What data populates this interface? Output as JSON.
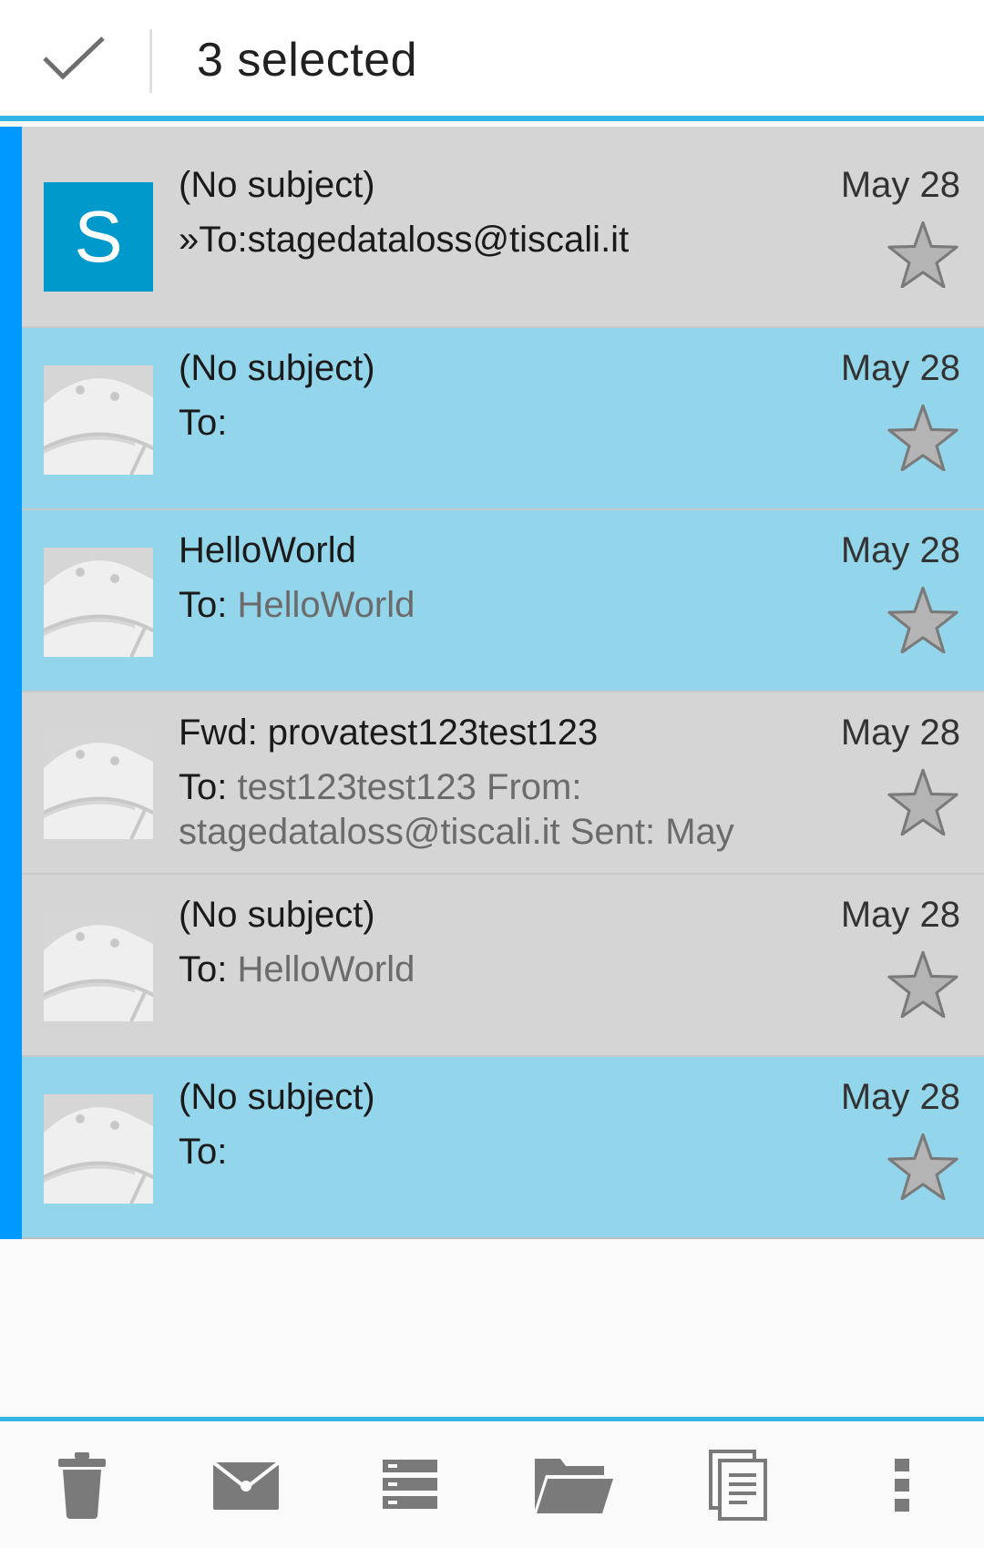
{
  "action_bar": {
    "selected_label": "3 selected",
    "done_icon": "check-icon"
  },
  "messages": [
    {
      "subject": "(No subject)",
      "to_prefix": "»To:",
      "to_value": "stagedataloss@tiscali.it",
      "date": "May 28",
      "avatar_letter": "S",
      "avatar_type": "letter",
      "selected": false,
      "starred": false
    },
    {
      "subject": "(No subject)",
      "to_prefix": "To:",
      "to_value": "",
      "date": "May 28",
      "avatar_type": "android",
      "selected": true,
      "starred": false
    },
    {
      "subject": "HelloWorld",
      "to_prefix": "To:",
      "to_value": " HelloWorld",
      "date": "May 28",
      "avatar_type": "android",
      "selected": true,
      "starred": false
    },
    {
      "subject": "Fwd: provatest123test123",
      "to_prefix": "To:",
      "to_value": " test123test123 From: stagedataloss@tiscali.it Sent: May",
      "date": "May 28",
      "avatar_type": "android",
      "selected": false,
      "starred": false
    },
    {
      "subject": "(No subject)",
      "to_prefix": "To:",
      "to_value": " HelloWorld",
      "date": "May 28",
      "avatar_type": "android",
      "selected": false,
      "starred": false
    },
    {
      "subject": "(No subject)",
      "to_prefix": "To:",
      "to_value": "",
      "date": "May 28",
      "avatar_type": "android",
      "selected": true,
      "starred": false
    }
  ],
  "bottom_bar": {
    "icons": [
      "delete-icon",
      "mark-read-icon",
      "archive-icon",
      "move-folder-icon",
      "copy-icon",
      "overflow-menu-icon"
    ]
  },
  "colors": {
    "accent": "#33b5e5",
    "selected_row": "#93d5ea",
    "unselected_row": "#d5d5d5",
    "account_strip": "#0099ff",
    "avatar_letter_bg": "#0099cc"
  }
}
